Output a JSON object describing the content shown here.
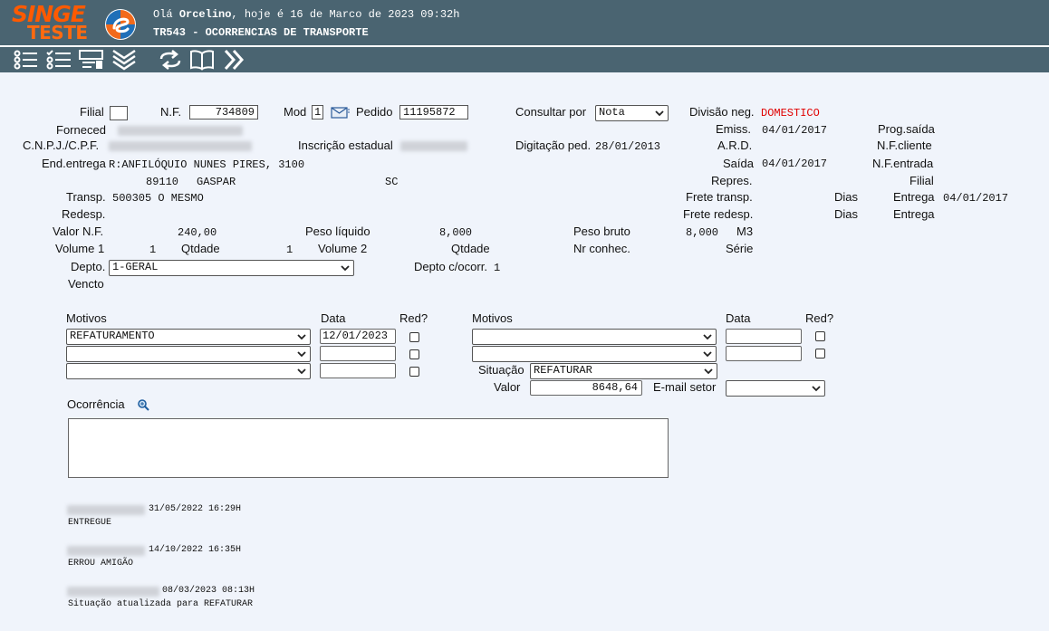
{
  "header": {
    "logo_main": "SINGE",
    "logo_sub": "TESTE",
    "greeting_prefix": "Olá ",
    "user": "Orcelino",
    "greeting_suffix": ", hoje é 16 de Marco de 2023 09:32h",
    "screen_title": "TR543 - OCORRENCIAS DE TRANSPORTE"
  },
  "toolbar": {
    "icons": [
      "list-icon",
      "checklist-icon",
      "form-icon",
      "collapse-icon",
      "refresh-icon",
      "book-icon",
      "forward-icon"
    ]
  },
  "form": {
    "filial_label": "Filial",
    "filial_value": "",
    "nf_label": "N.F.",
    "nf_value": "734809",
    "mod_label": "Mod",
    "mod_value": "1",
    "pedido_label": "Pedido",
    "pedido_value": "11195872",
    "consultar_label": "Consultar por",
    "consultar_value": "Nota",
    "divisao_label": "Divisão neg.",
    "divisao_value": "DOMESTICO",
    "fornecedor_label": "Forneced",
    "cnpj_label": "C.N.P.J./C.P.F.",
    "inscricao_label": "Inscrição estadual",
    "digitacao_label": "Digitação ped.",
    "digitacao_value": "28/01/2013",
    "emiss_label": "Emiss.",
    "emiss_value": "04/01/2017",
    "prog_saida_label": "Prog.saída",
    "ard_label": "A.R.D.",
    "nf_cliente_label": "N.F.cliente",
    "end_entrega_label": "End.entrega",
    "end_entrega_value": "R:ANFILÓQUIO NUNES PIRES, 3100",
    "cep_value": "89110",
    "cidade_value": "GASPAR",
    "uf_value": "SC",
    "saida_label": "Saída",
    "saida_value": "04/01/2017",
    "nf_entrada_label": "N.F.entrada",
    "repres_label": "Repres.",
    "filial2_label": "Filial",
    "transp_label": "Transp.",
    "transp_value": "500305 O MESMO",
    "frete_transp_label": "Frete transp.",
    "dias1_label": "Dias",
    "entrega1_label": "Entrega",
    "entrega1_value": "04/01/2017",
    "redesp_label": "Redesp.",
    "frete_redesp_label": "Frete redesp.",
    "dias2_label": "Dias",
    "entrega2_label": "Entrega",
    "valor_nf_label": "Valor N.F.",
    "valor_nf_value": "240,00",
    "peso_liquido_label": "Peso líquido",
    "peso_liquido_value": "8,000",
    "peso_bruto_label": "Peso bruto",
    "peso_bruto_value": "8,000",
    "m3_label": "M3",
    "volume1_label": "Volume 1",
    "volume1_value": "1",
    "qtdade1_label": "Qtdade",
    "qtdade1_value": "1",
    "volume2_label": "Volume 2",
    "qtdade2_label": "Qtdade",
    "nr_conhec_label": "Nr conhec.",
    "serie_label": "Série",
    "depto_label": "Depto.",
    "depto_value": "1-GERAL",
    "depto_ocorr_label": "Depto c/ocorr.",
    "depto_ocorr_value": "1",
    "vencto_label": "Vencto"
  },
  "motivos": {
    "left_header": "Motivos",
    "data_header": "Data",
    "red_header": "Red?",
    "right_header": "Motivos",
    "right_data_header": "Data",
    "right_red_header": "Red?",
    "left_rows": [
      {
        "motivo": "REFATURAMENTO",
        "data": "12/01/2023"
      },
      {
        "motivo": "",
        "data": ""
      },
      {
        "motivo": "",
        "data": ""
      }
    ],
    "right_rows": [
      {
        "motivo": "",
        "data": ""
      },
      {
        "motivo": "",
        "data": ""
      }
    ],
    "situacao_label": "Situação",
    "situacao_value": "REFATURAR",
    "valor_label": "Valor",
    "valor_value": "8648,64",
    "email_label": "E-mail setor",
    "email_value": ""
  },
  "ocorrencia": {
    "label": "Ocorrência",
    "text": ""
  },
  "history": [
    {
      "timestamp": "31/05/2022 16:29H",
      "message": "ENTREGUE"
    },
    {
      "timestamp": "14/10/2022 16:35H",
      "message": "ERROU AMIGÃO"
    },
    {
      "timestamp": "08/03/2023 08:13H",
      "message": "Situação atualizada para REFATURAR"
    }
  ],
  "colors": {
    "header_bg": "#4a6471",
    "page_bg": "#f0f4fb",
    "logo_orange": "#ff5a00",
    "division_red": "#e00000"
  }
}
